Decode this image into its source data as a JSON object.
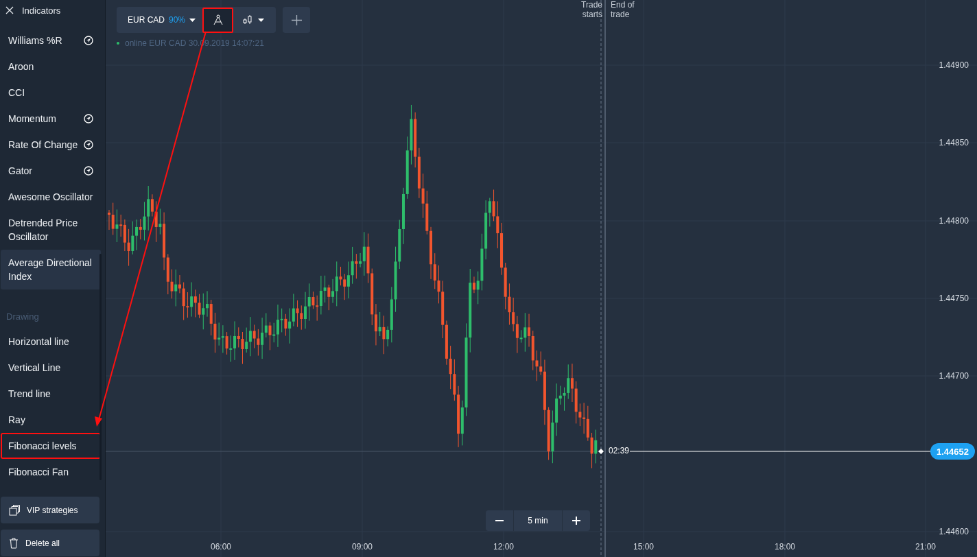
{
  "sidebar": {
    "title": "Indicators",
    "indicators": [
      {
        "label": "Williams %R",
        "has_icon": true,
        "selected": false,
        "highlighted": false
      },
      {
        "label": "Aroon",
        "has_icon": false,
        "selected": false,
        "highlighted": false
      },
      {
        "label": "CCI",
        "has_icon": false,
        "selected": false,
        "highlighted": false
      },
      {
        "label": "Momentum",
        "has_icon": true,
        "selected": false,
        "highlighted": false
      },
      {
        "label": "Rate Of Change",
        "has_icon": true,
        "selected": false,
        "highlighted": false
      },
      {
        "label": "Gator",
        "has_icon": true,
        "selected": false,
        "highlighted": false
      },
      {
        "label": "Awesome Oscillator",
        "has_icon": false,
        "selected": false,
        "highlighted": false
      },
      {
        "label": "Detrended Price Oscillator",
        "has_icon": false,
        "selected": false,
        "highlighted": false
      },
      {
        "label": "Average Directional Index",
        "has_icon": false,
        "selected": true,
        "highlighted": false
      }
    ],
    "drawing_heading": "Drawing",
    "drawing_tools": [
      {
        "label": "Horizontal line",
        "has_icon": false,
        "selected": false,
        "highlighted": false
      },
      {
        "label": "Vertical Line",
        "has_icon": false,
        "selected": false,
        "highlighted": false
      },
      {
        "label": "Trend line",
        "has_icon": false,
        "selected": false,
        "highlighted": false
      },
      {
        "label": "Ray",
        "has_icon": false,
        "selected": false,
        "highlighted": false
      },
      {
        "label": "Fibonacci levels",
        "has_icon": false,
        "selected": false,
        "highlighted": true
      },
      {
        "label": "Fibonacci Fan",
        "has_icon": false,
        "selected": false,
        "highlighted": false
      }
    ],
    "buttons": [
      {
        "kind": "strategies",
        "label": "VIP strategies"
      },
      {
        "kind": "delete",
        "label": "Delete all"
      }
    ]
  },
  "toolbar": {
    "asset": "EUR CAD",
    "payout": "90%",
    "draw_tool": {
      "highlighted": true
    }
  },
  "status": {
    "online": true,
    "text": "online EUR CAD 30.09.2019 14:07:21"
  },
  "chart": {
    "y_labels": [
      "1.44900",
      "1.44850",
      "1.44800",
      "1.44750",
      "1.44700",
      "1.44600"
    ],
    "x_labels": [
      "06:00",
      "09:00",
      "12:00",
      "15:00",
      "18:00",
      "21:00"
    ],
    "trade_starts": "Trade starts",
    "end_of_trade": "End of trade",
    "timer": "02:39",
    "price": "1.44652"
  },
  "zoom": {
    "interval": "5 min"
  },
  "annotation": {
    "arrow": true
  }
}
